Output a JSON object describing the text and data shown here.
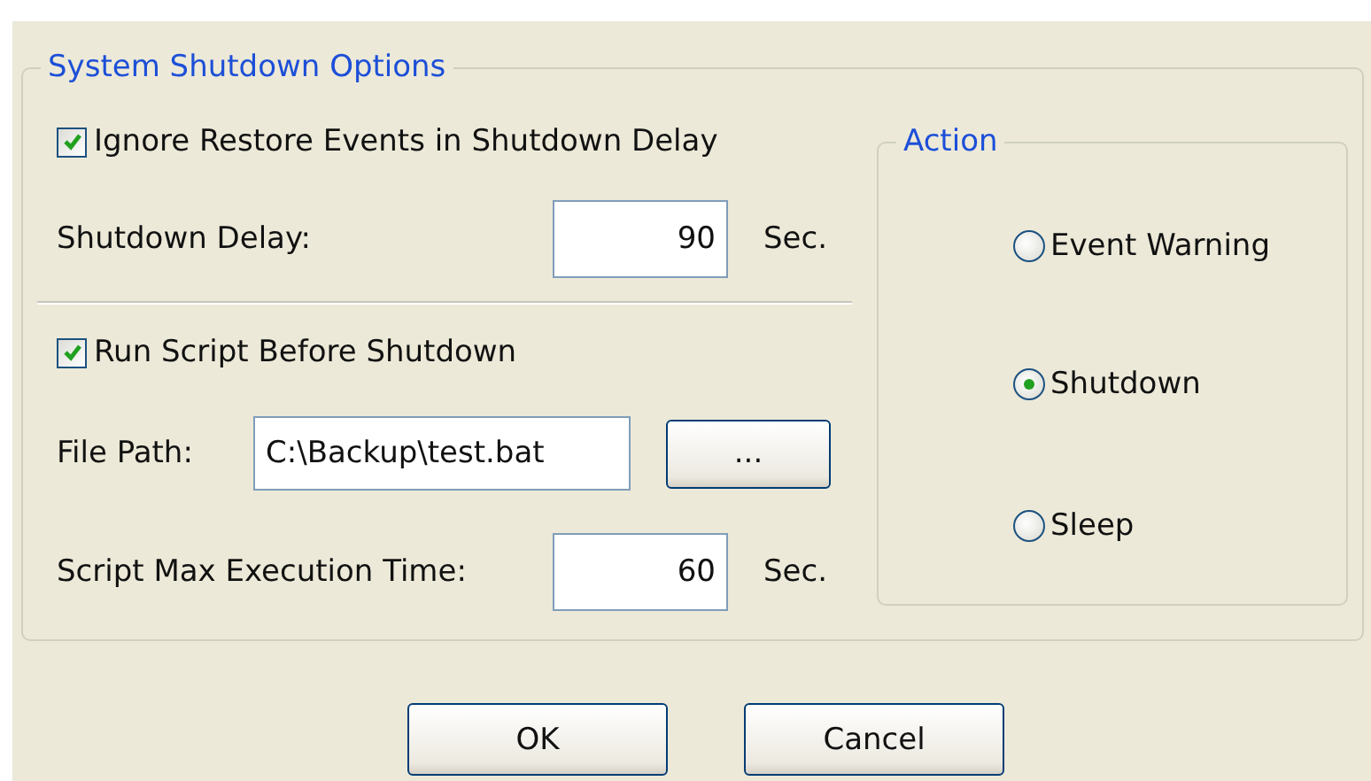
{
  "group": {
    "title": "System Shutdown Options"
  },
  "ignore_restore": {
    "label": "Ignore Restore Events in Shutdown Delay",
    "checked": true
  },
  "shutdown_delay": {
    "label": "Shutdown Delay:",
    "value": "90",
    "unit": "Sec."
  },
  "run_script": {
    "label": "Run Script Before Shutdown",
    "checked": true
  },
  "file_path": {
    "label": "File Path:",
    "value": "C:\\Backup\\test.bat",
    "browse": "..."
  },
  "max_time": {
    "label": "Script Max Execution Time:",
    "value": "60",
    "unit": "Sec."
  },
  "action": {
    "title": "Action",
    "options": [
      {
        "label": "Event Warning",
        "selected": false
      },
      {
        "label": "Shutdown",
        "selected": true
      },
      {
        "label": "Sleep",
        "selected": false
      }
    ]
  },
  "buttons": [
    "OK",
    "Cancel"
  ]
}
